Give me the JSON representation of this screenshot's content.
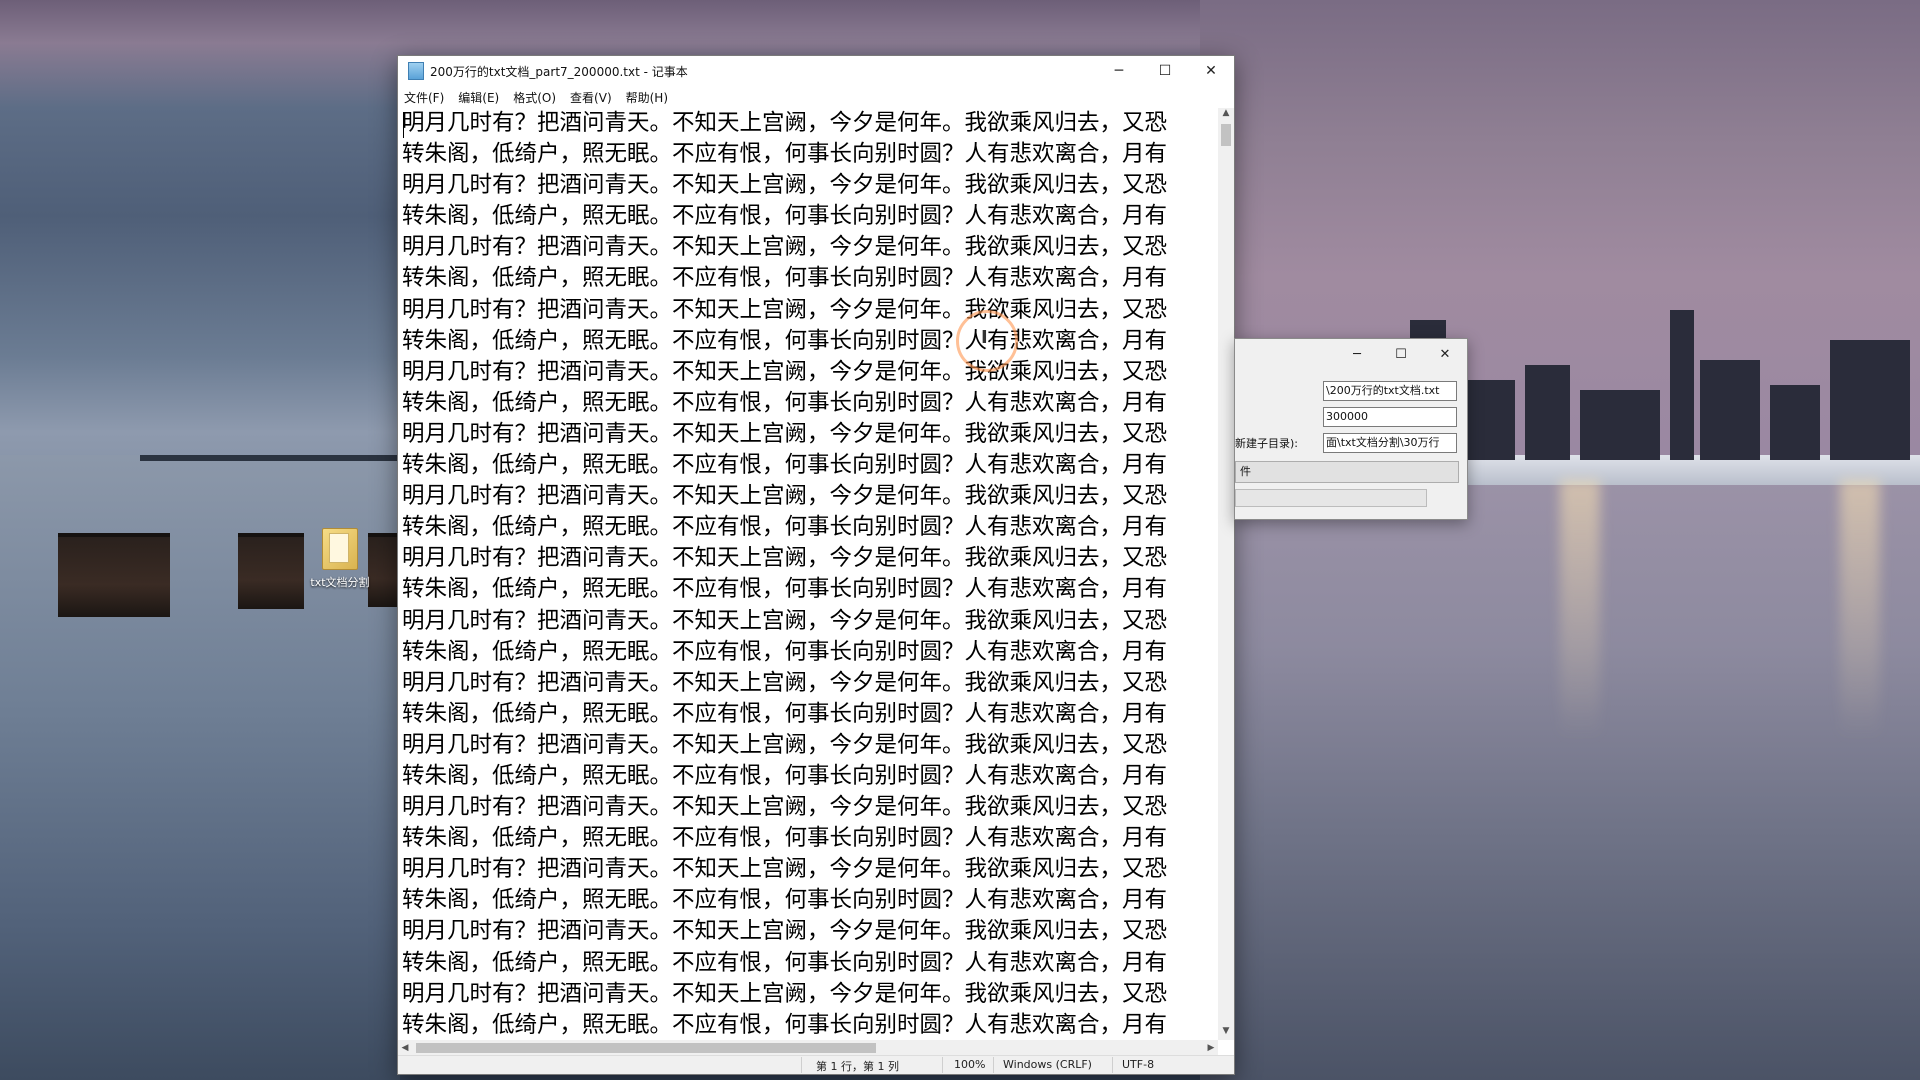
{
  "desktop": {
    "icon_label": "txt文档分割"
  },
  "notepad": {
    "title": "200万行的txt文档_part7_200000.txt - 记事本",
    "window_controls": {
      "minimize": "─",
      "maximize": "☐",
      "close": "✕"
    },
    "menu": [
      "文件(F)",
      "编辑(E)",
      "格式(O)",
      "查看(V)",
      "帮助(H)"
    ],
    "lines": [
      "明月几时有？把酒问青天。不知天上宫阙，今夕是何年。我欲乘风归去，又恐",
      "转朱阁，低绮户，照无眠。不应有恨，何事长向别时圆？人有悲欢离合，月有",
      "明月几时有？把酒问青天。不知天上宫阙，今夕是何年。我欲乘风归去，又恐",
      "转朱阁，低绮户，照无眠。不应有恨，何事长向别时圆？人有悲欢离合，月有",
      "明月几时有？把酒问青天。不知天上宫阙，今夕是何年。我欲乘风归去，又恐",
      "转朱阁，低绮户，照无眠。不应有恨，何事长向别时圆？人有悲欢离合，月有",
      "明月几时有？把酒问青天。不知天上宫阙，今夕是何年。我欲乘风归去，又恐",
      "转朱阁，低绮户，照无眠。不应有恨，何事长向别时圆？人有悲欢离合，月有",
      "明月几时有？把酒问青天。不知天上宫阙，今夕是何年。我欲乘风归去，又恐",
      "转朱阁，低绮户，照无眠。不应有恨，何事长向别时圆？人有悲欢离合，月有",
      "明月几时有？把酒问青天。不知天上宫阙，今夕是何年。我欲乘风归去，又恐",
      "转朱阁，低绮户，照无眠。不应有恨，何事长向别时圆？人有悲欢离合，月有",
      "明月几时有？把酒问青天。不知天上宫阙，今夕是何年。我欲乘风归去，又恐",
      "转朱阁，低绮户，照无眠。不应有恨，何事长向别时圆？人有悲欢离合，月有",
      "明月几时有？把酒问青天。不知天上宫阙，今夕是何年。我欲乘风归去，又恐",
      "转朱阁，低绮户，照无眠。不应有恨，何事长向别时圆？人有悲欢离合，月有",
      "明月几时有？把酒问青天。不知天上宫阙，今夕是何年。我欲乘风归去，又恐",
      "转朱阁，低绮户，照无眠。不应有恨，何事长向别时圆？人有悲欢离合，月有",
      "明月几时有？把酒问青天。不知天上宫阙，今夕是何年。我欲乘风归去，又恐",
      "转朱阁，低绮户，照无眠。不应有恨，何事长向别时圆？人有悲欢离合，月有",
      "明月几时有？把酒问青天。不知天上宫阙，今夕是何年。我欲乘风归去，又恐",
      "转朱阁，低绮户，照无眠。不应有恨，何事长向别时圆？人有悲欢离合，月有",
      "明月几时有？把酒问青天。不知天上宫阙，今夕是何年。我欲乘风归去，又恐",
      "转朱阁，低绮户，照无眠。不应有恨，何事长向别时圆？人有悲欢离合，月有",
      "明月几时有？把酒问青天。不知天上宫阙，今夕是何年。我欲乘风归去，又恐",
      "转朱阁，低绮户，照无眠。不应有恨，何事长向别时圆？人有悲欢离合，月有",
      "明月几时有？把酒问青天。不知天上宫阙，今夕是何年。我欲乘风归去，又恐",
      "转朱阁，低绮户，照无眠。不应有恨，何事长向别时圆？人有悲欢离合，月有",
      "明月几时有？把酒问青天。不知天上宫阙，今夕是何年。我欲乘风归去，又恐",
      "转朱阁，低绮户，照无眠。不应有恨，何事长向别时圆？人有悲欢离合，月有"
    ],
    "status": {
      "position": "第 1 行，第 1 列",
      "zoom": "100%",
      "line_ending": "Windows (CRLF)",
      "encoding": "UTF-8"
    }
  },
  "splitter_dialog": {
    "window_controls": {
      "minimize": "─",
      "maximize": "☐",
      "close": "✕"
    },
    "file_path_value": "\\200万行的txt文档.txt",
    "lines_per_file_value": "300000",
    "output_dir_label": "新建子目录):",
    "output_dir_value": "面\\txt文档分割\\30万行",
    "action_button_label": "件"
  },
  "colors": {
    "notepad_bg": "#ffffff",
    "chrome": "#f0f0f0",
    "text": "#000000"
  }
}
